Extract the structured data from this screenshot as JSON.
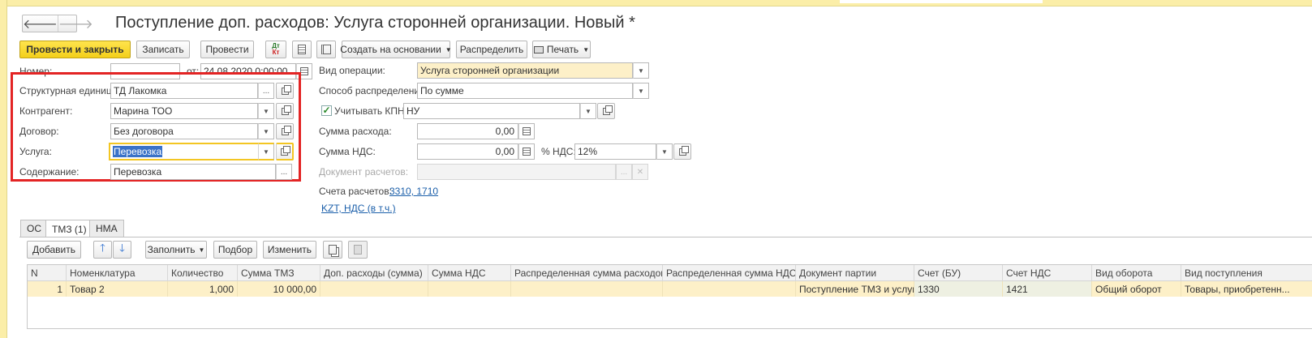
{
  "header": {
    "title": "Поступление доп. расходов: Услуга сторонней организации. Новый *",
    "back": "🡐",
    "forward": "🡒"
  },
  "toolbar": {
    "post_close": "Провести и закрыть",
    "save": "Записать",
    "post": "Провести",
    "dtkt": "Дт Кт",
    "create_based": "Создать на основании",
    "distribute": "Распределить",
    "print": "Печать"
  },
  "form": {
    "number_label": "Номер:",
    "number_value": "",
    "date_label": "от:",
    "date_value": "24.08.2020  0:00:00",
    "unit_label": "Структурная единица:",
    "unit_value": "ТД Лакомка",
    "counterparty_label": "Контрагент:",
    "counterparty_value": "Марина ТОО",
    "contract_label": "Договор:",
    "contract_value": "Без договора",
    "service_label": "Услуга:",
    "service_value": "Перевозка",
    "content_label": "Содержание:",
    "content_value": "Перевозка",
    "op_label": "Вид операции:",
    "op_value": "Услуга сторонней организации",
    "dist_label": "Способ распределения:",
    "dist_value": "По сумме",
    "kpn_label": "Учитывать КПН",
    "kpn_value": "НУ",
    "kpn_checked": true,
    "sum_label": "Сумма расхода:",
    "sum_value": "0,00",
    "vat_label": "Сумма НДС:",
    "vat_value": "0,00",
    "vat_rate_label": "% НДС:",
    "vat_rate_value": "12%",
    "doc_label": "Документ расчетов:",
    "doc_value": "",
    "accounts_label": "Счета расчетов:",
    "accounts_value": "3310, 1710",
    "currency_link": "KZT, НДС (в т.ч.)"
  },
  "tabs": [
    {
      "label": "ОС",
      "active": false
    },
    {
      "label": "ТМЗ (1)",
      "active": true
    },
    {
      "label": "НМА",
      "active": false
    }
  ],
  "table_toolbar": {
    "add": "Добавить",
    "up_icon": "arrow-up-icon",
    "down_icon": "arrow-down-icon",
    "fill": "Заполнить",
    "select": "Подбор",
    "change": "Изменить"
  },
  "table": {
    "columns": [
      "N",
      "Номенклатура",
      "Количество",
      "Сумма ТМЗ",
      "Доп. расходы (сумма)",
      "Сумма НДС",
      "Распределенная сумма расходов",
      "Распределенная сумма НДС",
      "Документ партии",
      "Счет (БУ)",
      "Счет НДС",
      "Вид оборота",
      "Вид поступления"
    ],
    "rows": [
      [
        "1",
        "Товар 2",
        "1,000",
        "10 000,00",
        "",
        "",
        "",
        "",
        "Поступление ТМЗ и услуг ...",
        "1330",
        "1421",
        "Общий оборот",
        "Товары, приобретенн..."
      ]
    ]
  },
  "colors": {
    "accent": "#f3cf1a",
    "highlight_border": "#e32424",
    "selection": "#fdf0c8",
    "link": "#1b5faa"
  }
}
